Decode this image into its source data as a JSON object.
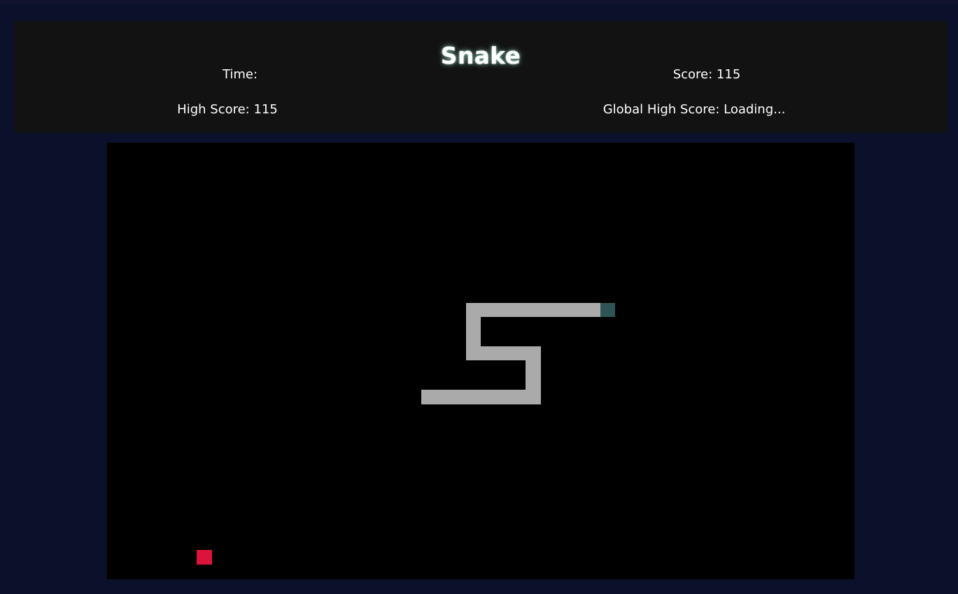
{
  "game": {
    "title": "Snake",
    "time_label": "Time:",
    "score_label": "Score: 115",
    "high_score_label": "High Score: 115",
    "global_high_score_label": "Global High Score: Loading..."
  },
  "colors": {
    "background": "#0b112b",
    "header_bg": "#121212",
    "board_bg": "#000000",
    "snake_body": "#aaaaaa",
    "snake_head": "#2f5455",
    "food": "#dc143c"
  }
}
